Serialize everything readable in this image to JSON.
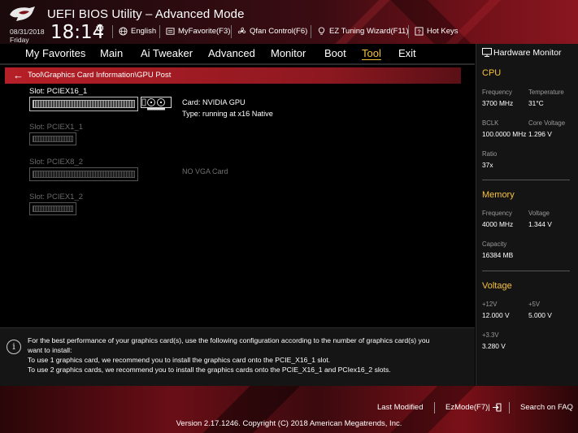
{
  "header": {
    "title": "UEFI BIOS Utility – Advanced Mode",
    "date": "08/31/2018",
    "day": "Friday",
    "time": "18:14",
    "items": [
      {
        "label": "English",
        "icon": "globe-icon"
      },
      {
        "label": "MyFavorite(F3)",
        "icon": "favorite-icon"
      },
      {
        "label": "Qfan Control(F6)",
        "icon": "fan-icon"
      },
      {
        "label": "EZ Tuning Wizard(F11)",
        "icon": "lightbulb-icon"
      },
      {
        "label": "Hot Keys",
        "icon": "help-icon"
      }
    ]
  },
  "menu": {
    "items": [
      "My Favorites",
      "Main",
      "Ai Tweaker",
      "Advanced",
      "Monitor",
      "Boot",
      "Tool",
      "Exit"
    ],
    "active": "Tool"
  },
  "breadcrumb": "Tool\\Graphics Card Information\\GPU Post",
  "slots": [
    {
      "label": "Slot: PCIEX16_1",
      "active": true
    },
    {
      "label": "Slot: PCIEX1_1",
      "active": false
    },
    {
      "label": "Slot: PCIEX8_2",
      "active": false
    },
    {
      "label": "Slot: PCIEX1_2",
      "active": false
    }
  ],
  "card_info": {
    "card": "Card: NVIDIA GPU",
    "type": "Type: running at x16 Native",
    "no_vga": "NO VGA Card"
  },
  "info_panel": {
    "lines": [
      "For the best performance of your graphics card(s), use the following configuration according to the number of graphics card(s) you",
      "want to install:",
      "To use 1 graphics card, we recommend you to install  the graphics card onto the PCIE_X16_1 slot.",
      "To use 2 graphics cards, we recommend you to install the graphics cards onto the PCIE_X16_1 and PCIex16_2 slots."
    ]
  },
  "hardware_monitor": {
    "title": "Hardware Monitor",
    "cpu": {
      "title": "CPU",
      "frequency_label": "Frequency",
      "frequency": "3700 MHz",
      "temperature_label": "Temperature",
      "temperature": "31°C",
      "bclk_label": "BCLK",
      "bclk": "100.0000 MHz",
      "core_voltage_label": "Core Voltage",
      "core_voltage": "1.296 V",
      "ratio_label": "Ratio",
      "ratio": "37x"
    },
    "memory": {
      "title": "Memory",
      "frequency_label": "Frequency",
      "frequency": "4000 MHz",
      "voltage_label": "Voltage",
      "voltage": "1.344 V",
      "capacity_label": "Capacity",
      "capacity": "16384 MB"
    },
    "voltage": {
      "title": "Voltage",
      "v12_label": "+12V",
      "v12": "12.000 V",
      "v5_label": "+5V",
      "v5": "5.000 V",
      "v33_label": "+3.3V",
      "v33": "3.280 V"
    }
  },
  "footer": {
    "last_modified": "Last Modified",
    "ezmode": "EzMode(F7)|",
    "search": "Search on FAQ",
    "version": "Version 2.17.1246. Copyright (C) 2018 American Megatrends, Inc."
  },
  "colors": {
    "accent": "#f6c23e",
    "breadcrumb_red": "#b61f27"
  }
}
